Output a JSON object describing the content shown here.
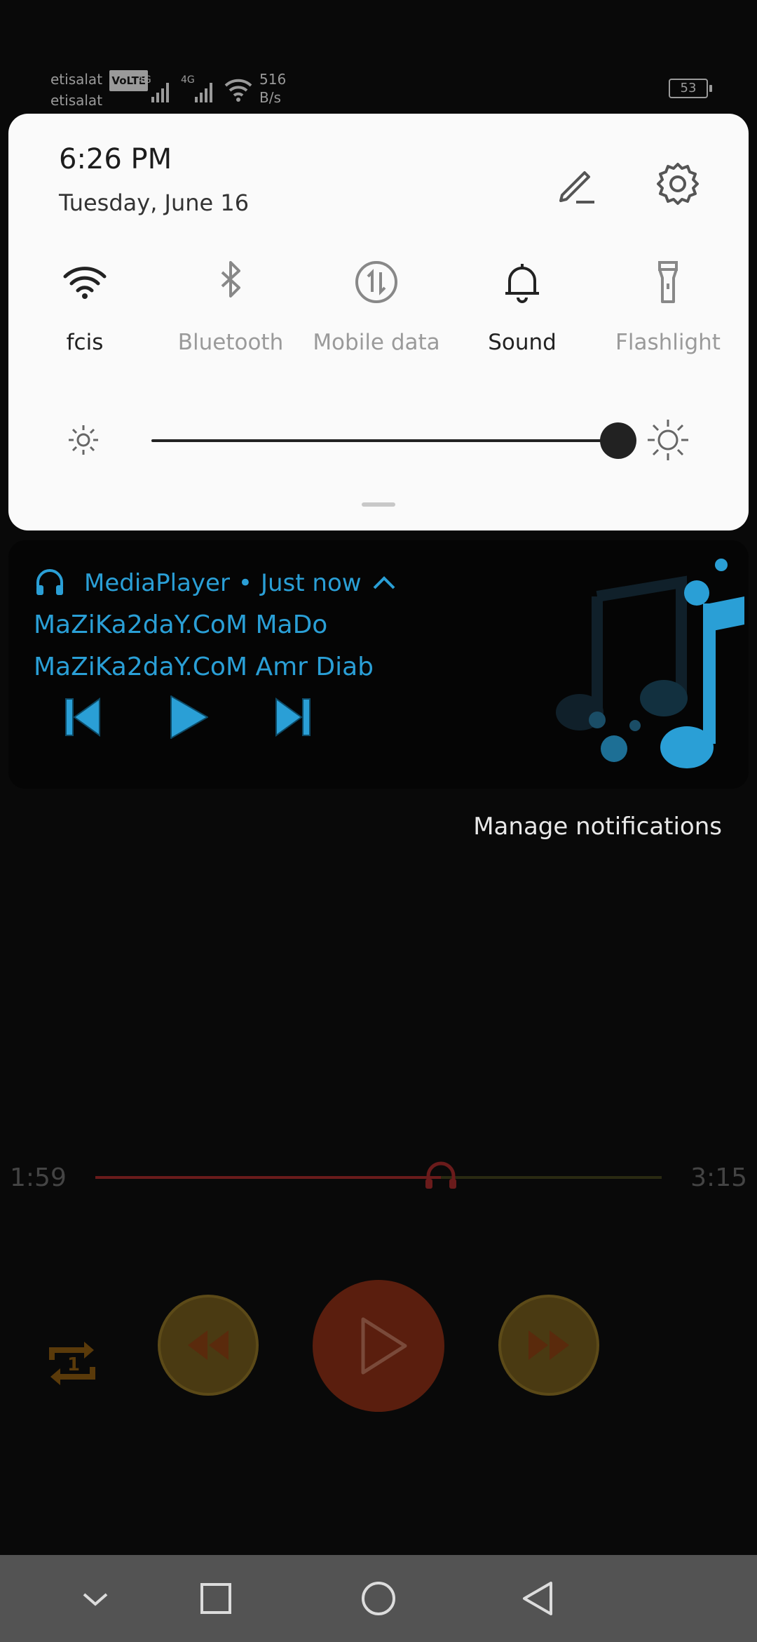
{
  "status_bar": {
    "carrier_1": "etisalat",
    "carrier_1_badge": "VoLTE",
    "carrier_2": "etisalat",
    "network_1": "4G",
    "network_2": "4G",
    "speed_value": "516",
    "speed_unit": "B/s",
    "battery": "53"
  },
  "quick_settings": {
    "time": "6:26 PM",
    "date": "Tuesday, June 16",
    "tiles": [
      {
        "label": "fcis",
        "icon": "wifi-icon",
        "active": true
      },
      {
        "label": "Bluetooth",
        "icon": "bluetooth-icon",
        "active": false
      },
      {
        "label": "Mobile data",
        "icon": "mobile-data-icon",
        "active": false
      },
      {
        "label": "Sound",
        "icon": "bell-icon",
        "active": true
      },
      {
        "label": "Flashlight",
        "icon": "flashlight-icon",
        "active": false
      }
    ],
    "brightness": 0.98
  },
  "notification": {
    "app_name": "MediaPlayer",
    "separator": "•",
    "time": "Just now",
    "title": "MaZiKa2daY.CoM MaDo",
    "subtitle": "MaZiKa2daY.CoM Amr Diab",
    "accent": "#2a9fd6"
  },
  "manage_notifications": "Manage notifications",
  "player": {
    "position": "1:59",
    "duration": "3:15",
    "progress": 0.61
  }
}
